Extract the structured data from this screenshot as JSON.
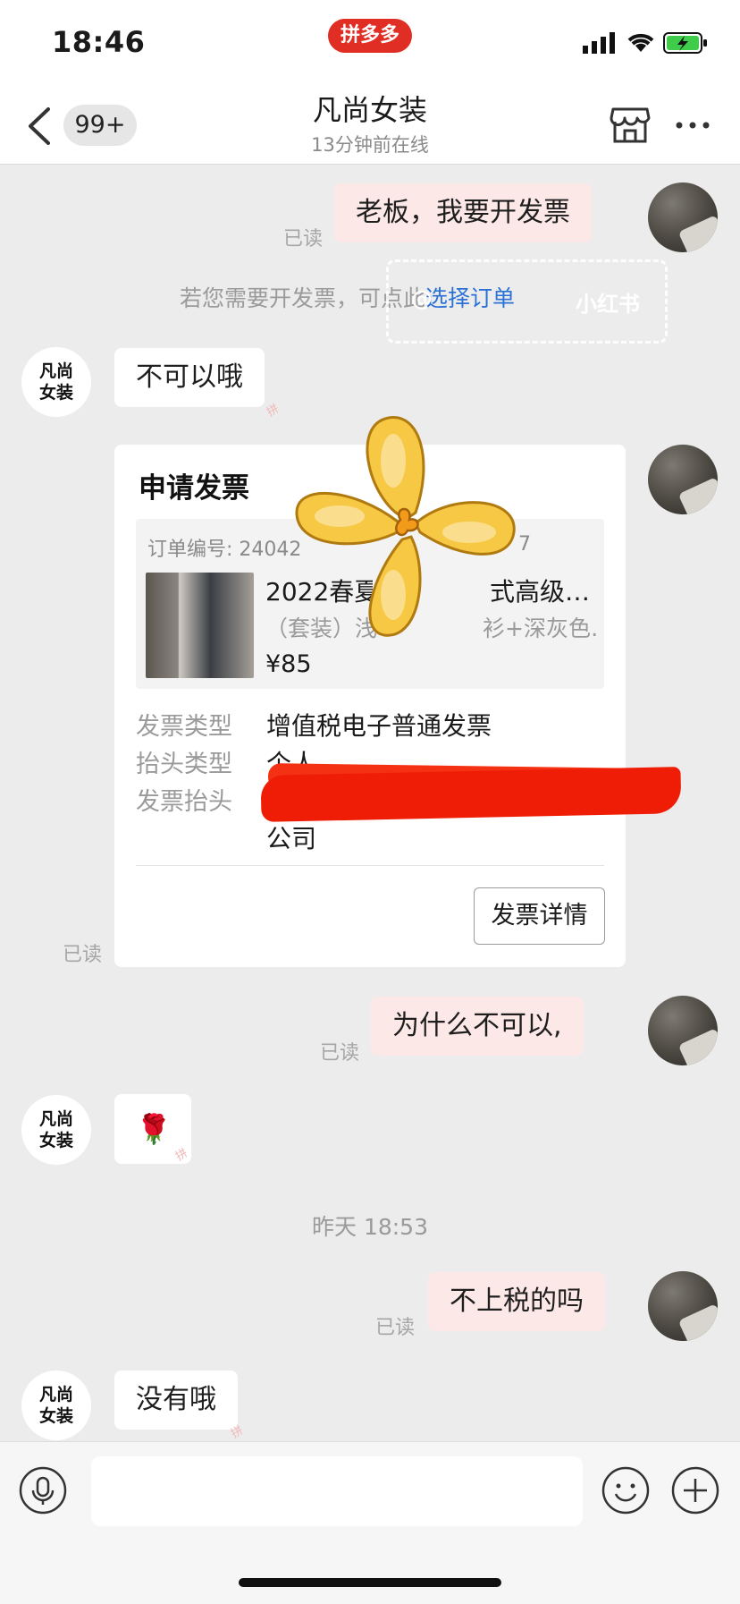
{
  "status_bar": {
    "time": "18:46",
    "app_badge": "拼多多"
  },
  "header": {
    "unread_count": "99+",
    "title": "凡尚女装",
    "subtitle": "13分钟前在线"
  },
  "shop_avatar_text": "凡尚\n女装",
  "messages": {
    "m1": {
      "text": "老板，我要开发票",
      "read": "已读"
    },
    "system": {
      "text": "若您需要开发票，可点此",
      "link": "选择订单"
    },
    "watermark": {
      "left": "@",
      "right": "小红书"
    },
    "m2": {
      "text": "不可以哦"
    },
    "m3": {
      "read": "已读"
    },
    "m4": {
      "text": "为什么不可以,",
      "read": "已读"
    },
    "m5": {
      "emoji": "🌹"
    },
    "timestamp": "昨天 18:53",
    "m6": {
      "text": "不上税的吗",
      "read": "已读"
    },
    "m7": {
      "text": "没有哦"
    },
    "sticker_mark": "拼"
  },
  "invoice_card": {
    "title": "申请发票",
    "order_no": "订单编号: 24042",
    "order_no_tail": "7",
    "product_name": "2022春夏",
    "product_name_tail": "式高级…",
    "product_spec": "（套装）浅",
    "product_spec_tail": "衫+深灰色…",
    "price": "¥85",
    "rows": [
      {
        "label": "发票类型",
        "value": "增值税电子普通发票"
      },
      {
        "label": "抬头类型",
        "value": "个人"
      },
      {
        "label": "发票抬头",
        "value": "公司"
      }
    ],
    "detail_button": "发票详情"
  },
  "input": {
    "placeholder": ""
  },
  "colors": {
    "brand": "#e02e24",
    "my_bubble": "#fde8e8",
    "link": "#2b72d6",
    "redaction": "#f01d06"
  }
}
